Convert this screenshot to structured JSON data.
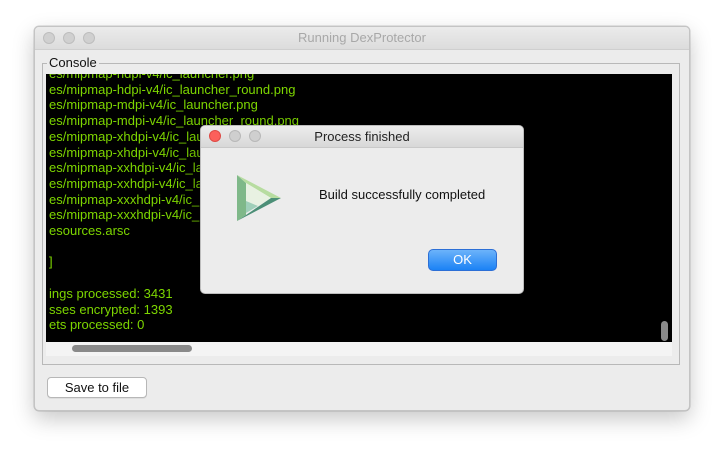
{
  "window": {
    "title": "Running DexProtector",
    "console_label": "Console",
    "save_button_label": "Save to file"
  },
  "console": {
    "lines": [
      "es/mipmap-hdpi-v4/ic_launcher.png",
      "es/mipmap-hdpi-v4/ic_launcher_round.png",
      "es/mipmap-mdpi-v4/ic_launcher.png",
      "es/mipmap-mdpi-v4/ic_launcher_round.png",
      "es/mipmap-xhdpi-v4/ic_launcher.png",
      "es/mipmap-xhdpi-v4/ic_launcher_round.png",
      "es/mipmap-xxhdpi-v4/ic_launcher.png",
      "es/mipmap-xxhdpi-v4/ic_launcher_round.png",
      "es/mipmap-xxxhdpi-v4/ic_launcher.png",
      "es/mipmap-xxxhdpi-v4/ic_launcher_round.png",
      "esources.arsc",
      "",
      "]",
      "",
      "ings processed: 3431",
      "sses encrypted: 1393",
      "ets processed: 0"
    ]
  },
  "dialog": {
    "title": "Process finished",
    "message": "Build successfully completed",
    "ok_label": "OK"
  },
  "colors": {
    "console_text": "#7dd600",
    "console_bg": "#000000",
    "ok_button": "#1b82f5",
    "close_button": "#fc605b"
  }
}
